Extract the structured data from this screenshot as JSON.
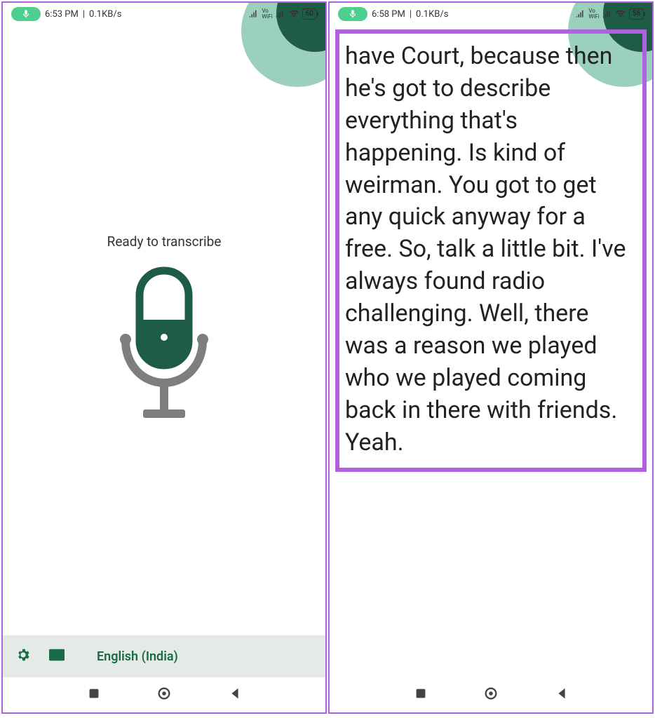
{
  "left": {
    "status": {
      "time": "6:53 PM",
      "speed": "0.1KB/s",
      "vowifi": "Vo\nWiFi",
      "battery": "60"
    },
    "main": {
      "ready_text": "Ready to transcribe"
    },
    "toolbar": {
      "language": "English (India)"
    }
  },
  "right": {
    "status": {
      "time": "6:58 PM",
      "speed": "0.1KB/s",
      "vowifi": "Vo\nWiFi",
      "battery": "58"
    },
    "transcript": {
      "text": "have Court, because then he's got to describe everything that's happening. Is kind of weirman. You got to get any quick anyway for a free. So, talk a little bit. I've always found radio challenging. Well, there was a reason we played who we played coming back in there with friends. Yeah."
    }
  }
}
